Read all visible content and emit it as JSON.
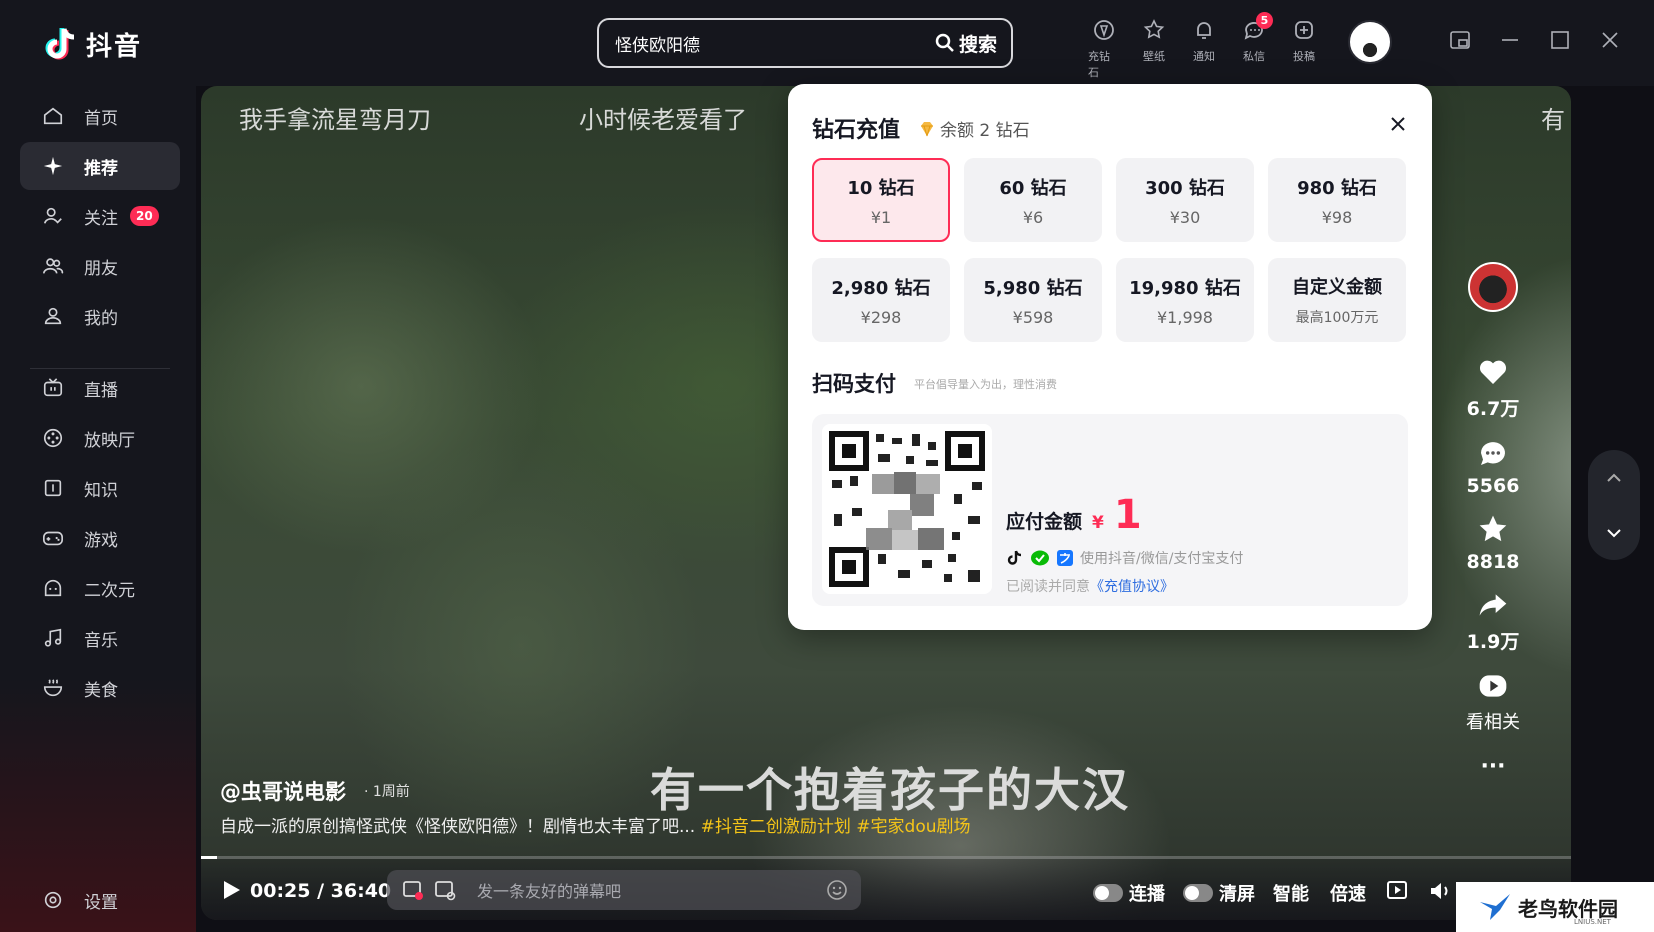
{
  "app": {
    "name": "抖音"
  },
  "search": {
    "value": "怪侠欧阳德",
    "button": "搜索"
  },
  "top_icons": [
    {
      "label": "充钻石",
      "icon": "diamond-icon"
    },
    {
      "label": "壁纸",
      "icon": "wallpaper-icon"
    },
    {
      "label": "通知",
      "icon": "bell-icon"
    },
    {
      "label": "私信",
      "icon": "message-icon",
      "badge": "5"
    },
    {
      "label": "投稿",
      "icon": "upload-icon"
    }
  ],
  "sidebar": {
    "items": [
      {
        "label": "首页",
        "icon": "home-icon"
      },
      {
        "label": "推荐",
        "icon": "sparkle-icon",
        "active": true
      },
      {
        "label": "关注",
        "icon": "follow-icon",
        "badge": "20"
      },
      {
        "label": "朋友",
        "icon": "friends-icon"
      },
      {
        "label": "我的",
        "icon": "user-icon"
      },
      {
        "label": "直播",
        "icon": "tv-icon"
      },
      {
        "label": "放映厅",
        "icon": "cinema-icon"
      },
      {
        "label": "知识",
        "icon": "book-icon"
      },
      {
        "label": "游戏",
        "icon": "gamepad-icon"
      },
      {
        "label": "二次元",
        "icon": "anime-icon"
      },
      {
        "label": "音乐",
        "icon": "music-icon"
      },
      {
        "label": "美食",
        "icon": "food-icon"
      }
    ],
    "settings": "设置"
  },
  "video": {
    "danmu": [
      "我手拿流星弯月刀",
      "小时候老爱看了",
      "有"
    ],
    "subtitle": "有一个抱着孩子的大汉",
    "author": "@虫哥说电影",
    "time_ago": "· 1周前",
    "description": "自成一派的原创搞怪武侠《怪侠欧阳德》！剧情也太丰富了吧...",
    "tags": [
      "#抖音二创激励计划",
      "#宅家dou剧场"
    ],
    "current_time": "00:25",
    "duration": "36:40",
    "progress": 0.0115
  },
  "actions": {
    "likes": "6.7万",
    "comments": "5566",
    "favorites": "8818",
    "shares": "1.9万",
    "related": "看相关",
    "more": "···"
  },
  "controls": {
    "danmu_placeholder": "发一条友好的弹幕吧",
    "autoplay": "连播",
    "clear_screen": "清屏",
    "smart": "智能",
    "speed": "倍速"
  },
  "recharge": {
    "title": "钻石充值",
    "balance": "余额 2 钻石",
    "packages": [
      {
        "amount": "10 钻石",
        "price": "¥1",
        "selected": true
      },
      {
        "amount": "60 钻石",
        "price": "¥6"
      },
      {
        "amount": "300 钻石",
        "price": "¥30"
      },
      {
        "amount": "980 钻石",
        "price": "¥98"
      },
      {
        "amount": "2,980 钻石",
        "price": "¥298"
      },
      {
        "amount": "5,980 钻石",
        "price": "¥598"
      },
      {
        "amount": "19,980 钻石",
        "price": "¥1,998"
      },
      {
        "amount": "自定义金额",
        "price": "最高100万元"
      }
    ],
    "scan_title": "扫码支付",
    "scan_note": "平台倡导量入为出，理性消费",
    "pay_label": "应付金额",
    "currency": "¥",
    "pay_amount": "1",
    "pay_methods": "使用抖音/微信/支付宝支付",
    "agree_prefix": "已阅读并同意",
    "agree_link": "《充值协议》"
  },
  "watermark": {
    "text": "老鸟软件园",
    "sub": "LNIUS.NET"
  },
  "colors": {
    "accent": "#fe2c55",
    "tag": "#f5c518",
    "link": "#2f6ee0"
  }
}
